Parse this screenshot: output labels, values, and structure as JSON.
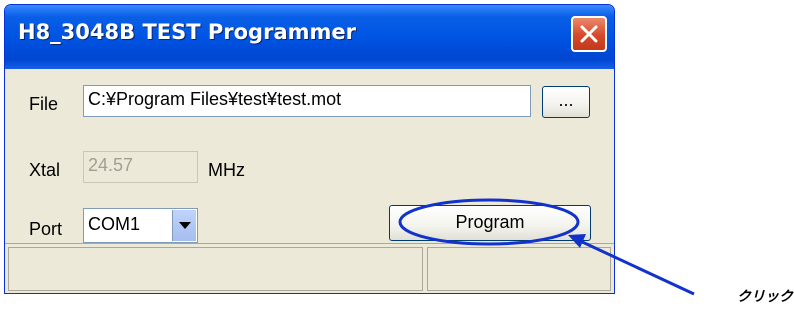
{
  "window": {
    "title": "H8_3048B TEST Programmer",
    "close_icon": "close-icon"
  },
  "file": {
    "label": "File",
    "value": "C:¥Program Files¥test¥test.mot",
    "browse_label": "..."
  },
  "xtal": {
    "label": "Xtal",
    "value": "24.57",
    "unit": "MHz"
  },
  "port": {
    "label": "Port",
    "selected": "COM1"
  },
  "program_button": {
    "label": "Program"
  },
  "annotation": {
    "text": "クリック",
    "color": "#1133cc"
  },
  "colors": {
    "titlebar": "#0054e3",
    "window_bg": "#ece9d8",
    "close_button": "#d6482a",
    "annotation": "#1133cc"
  }
}
